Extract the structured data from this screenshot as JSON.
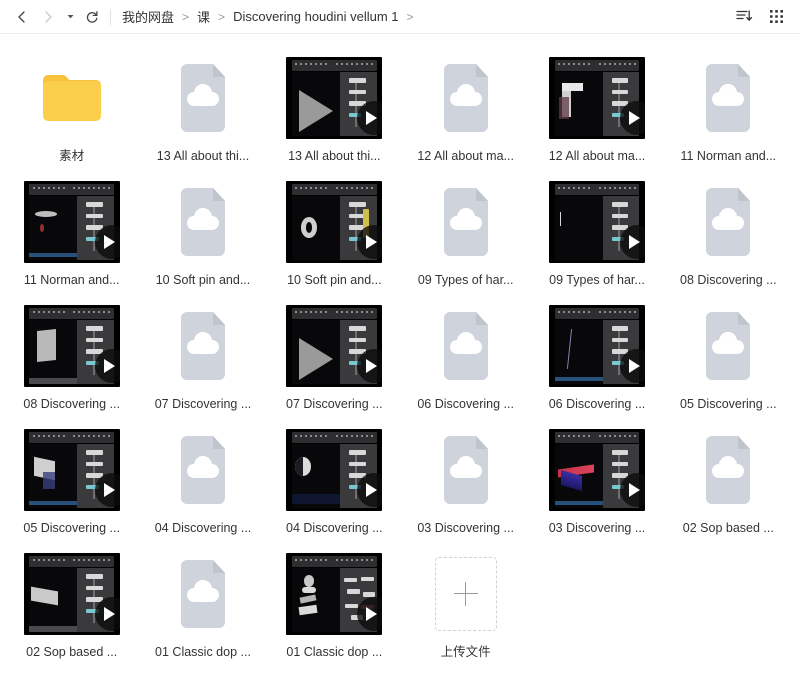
{
  "window": {
    "title": "Discovering houdini vellum 1"
  },
  "topbar": {
    "back_icon": "chevron-left-icon",
    "forward_icon": "chevron-right-icon",
    "history_caret_icon": "caret-down-icon",
    "refresh_icon": "refresh-icon",
    "sort_icon": "sort-descending-icon",
    "view_icon": "grid-view-icon"
  },
  "breadcrumb": {
    "items": [
      {
        "label": "我的网盘"
      },
      {
        "label": "课"
      },
      {
        "label": "Discovering houdini vellum 1"
      }
    ],
    "separator": ">",
    "trailing_separator": ">"
  },
  "colors": {
    "folder": "#FBCF4B",
    "folder_tab": "#F9C23C",
    "placeholder": "#CFD3DB",
    "placeholder_cloud": "#FFFFFF",
    "label_text": "#333333",
    "background": "#FFFFFF",
    "border": "#ECECEC",
    "upload_dash": "#D2D2D2"
  },
  "grid": {
    "columns": 6,
    "items": [
      {
        "label": "素材",
        "kind": "folder",
        "icon": "folder-icon"
      },
      {
        "label": "13 All about thi...",
        "kind": "placeholder",
        "icon": "cloud-file-icon"
      },
      {
        "label": "13 All about thi...",
        "kind": "video",
        "icon": "play-icon",
        "variant": "play-overlay"
      },
      {
        "label": "12 All about ma...",
        "kind": "placeholder",
        "icon": "cloud-file-icon"
      },
      {
        "label": "12 All about ma...",
        "kind": "video",
        "icon": "play-icon",
        "variant": "blocks"
      },
      {
        "label": "11 Norman and...",
        "kind": "placeholder",
        "icon": "cloud-file-icon"
      },
      {
        "label": "11 Norman and...",
        "kind": "video",
        "icon": "play-icon",
        "variant": "dark-blob"
      },
      {
        "label": "10 Soft pin and...",
        "kind": "placeholder",
        "icon": "cloud-file-icon"
      },
      {
        "label": "10 Soft pin and...",
        "kind": "video",
        "icon": "play-icon",
        "variant": "ring"
      },
      {
        "label": "09 Types of har...",
        "kind": "placeholder",
        "icon": "cloud-file-icon"
      },
      {
        "label": "09 Types of har...",
        "kind": "video",
        "icon": "play-icon",
        "variant": "sparse"
      },
      {
        "label": "08 Discovering ...",
        "kind": "placeholder",
        "icon": "cloud-file-icon"
      },
      {
        "label": "08 Discovering ...",
        "kind": "video",
        "icon": "play-icon",
        "variant": "panel-light"
      },
      {
        "label": "07 Discovering ...",
        "kind": "placeholder",
        "icon": "cloud-file-icon"
      },
      {
        "label": "07 Discovering ...",
        "kind": "video",
        "icon": "play-icon",
        "variant": "play-overlay"
      },
      {
        "label": "06 Discovering ...",
        "kind": "placeholder",
        "icon": "cloud-file-icon"
      },
      {
        "label": "06 Discovering ...",
        "kind": "video",
        "icon": "play-icon",
        "variant": "streak"
      },
      {
        "label": "05 Discovering ...",
        "kind": "placeholder",
        "icon": "cloud-file-icon"
      },
      {
        "label": "05 Discovering ...",
        "kind": "video",
        "icon": "play-icon",
        "variant": "cloth"
      },
      {
        "label": "04 Discovering ...",
        "kind": "placeholder",
        "icon": "cloud-file-icon"
      },
      {
        "label": "04 Discovering ...",
        "kind": "video",
        "icon": "play-icon",
        "variant": "sphere"
      },
      {
        "label": "03 Discovering ...",
        "kind": "placeholder",
        "icon": "cloud-file-icon"
      },
      {
        "label": "03 Discovering ...",
        "kind": "video",
        "icon": "play-icon",
        "variant": "gradient-plane"
      },
      {
        "label": "02 Sop based ...",
        "kind": "placeholder",
        "icon": "cloud-file-icon"
      },
      {
        "label": "02 Sop based ...",
        "kind": "video",
        "icon": "play-icon",
        "variant": "sheet"
      },
      {
        "label": "01 Classic dop ...",
        "kind": "placeholder",
        "icon": "cloud-file-icon"
      },
      {
        "label": "01 Classic dop ...",
        "kind": "video",
        "icon": "play-icon",
        "variant": "stack"
      },
      {
        "label": "上传文件",
        "kind": "upload",
        "icon": "plus-icon"
      }
    ]
  }
}
